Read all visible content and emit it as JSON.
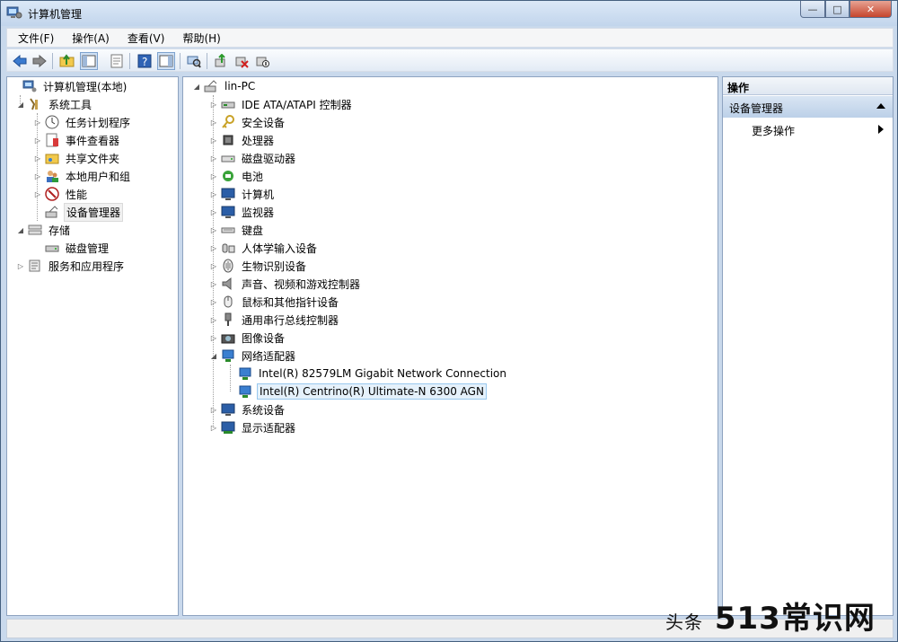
{
  "window": {
    "title": "计算机管理",
    "buttons": {
      "minimize": "—",
      "maximize": "□",
      "close": "✕"
    }
  },
  "menu": [
    "文件(F)",
    "操作(A)",
    "查看(V)",
    "帮助(H)"
  ],
  "left_tree": {
    "root": "计算机管理(本地)",
    "system_tools": "系统工具",
    "task_scheduler": "任务计划程序",
    "event_viewer": "事件查看器",
    "shared_folders": "共享文件夹",
    "local_users": "本地用户和组",
    "performance": "性能",
    "device_manager": "设备管理器",
    "storage": "存储",
    "disk_management": "磁盘管理",
    "services_apps": "服务和应用程序"
  },
  "device_tree": {
    "root": "lin-PC",
    "categories": [
      "IDE ATA/ATAPI 控制器",
      "安全设备",
      "处理器",
      "磁盘驱动器",
      "电池",
      "计算机",
      "监视器",
      "键盘",
      "人体学输入设备",
      "生物识别设备",
      "声音、视频和游戏控制器",
      "鼠标和其他指针设备",
      "通用串行总线控制器",
      "图像设备",
      "网络适配器"
    ],
    "network_children": [
      "Intel(R) 82579LM Gigabit Network Connection",
      "Intel(R) Centrino(R) Ultimate-N 6300 AGN"
    ],
    "after": [
      "系统设备",
      "显示适配器"
    ]
  },
  "actions": {
    "header": "操作",
    "section": "设备管理器",
    "more": "更多操作"
  },
  "watermark": {
    "small": "头条",
    "big": "513常识网"
  }
}
